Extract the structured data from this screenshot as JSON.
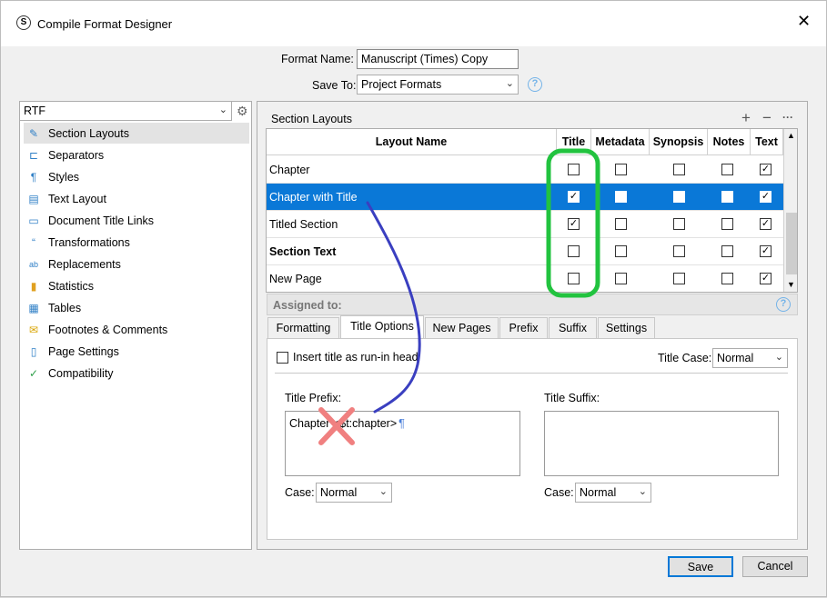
{
  "window": {
    "title": "Compile Format Designer",
    "close": "✕"
  },
  "format_name": {
    "label": "Format Name:",
    "value": "Manuscript (Times) Copy"
  },
  "save_to": {
    "label": "Save To:",
    "value": "Project Formats"
  },
  "left": {
    "output_select": "RTF",
    "items": [
      {
        "label": "Section Layouts",
        "icon": "✎"
      },
      {
        "label": "Separators",
        "icon": "⊏"
      },
      {
        "label": "Styles",
        "icon": "¶"
      },
      {
        "label": "Text Layout",
        "icon": "▤"
      },
      {
        "label": "Document Title Links",
        "icon": "▭"
      },
      {
        "label": "Transformations",
        "icon": "“"
      },
      {
        "label": "Replacements",
        "icon": "ab"
      },
      {
        "label": "Statistics",
        "icon": "▮"
      },
      {
        "label": "Tables",
        "icon": "▦"
      },
      {
        "label": "Footnotes & Comments",
        "icon": "✉"
      },
      {
        "label": "Page Settings",
        "icon": "▯"
      },
      {
        "label": "Compatibility",
        "icon": "✓"
      }
    ]
  },
  "section_layouts": {
    "heading": "Section Layouts",
    "add": "+",
    "remove": "−",
    "more": "···",
    "columns": [
      "Layout Name",
      "Title",
      "Metadata",
      "Synopsis",
      "Notes",
      "Text"
    ],
    "rows": [
      {
        "name": "Chapter",
        "checks": [
          "",
          "",
          "",
          "",
          "✓"
        ]
      },
      {
        "name": "Chapter with Title",
        "checks": [
          "✓",
          "",
          "",
          "",
          "✓"
        ]
      },
      {
        "name": "Titled Section",
        "checks": [
          "✓",
          "",
          "",
          "",
          "✓"
        ]
      },
      {
        "name": "Section Text",
        "checks": [
          "",
          "",
          "",
          "",
          "✓"
        ]
      },
      {
        "name": "New Page",
        "checks": [
          "",
          "",
          "",
          "",
          "✓"
        ]
      }
    ],
    "assigned_to": "Assigned to:"
  },
  "tabs": [
    "Formatting",
    "Title Options",
    "New Pages",
    "Prefix",
    "Suffix",
    "Settings"
  ],
  "title_options": {
    "run_in_label": "Insert title as run-in head",
    "title_case_label": "Title Case:",
    "title_case_value": "Normal",
    "prefix_label": "Title Prefix:",
    "prefix_value": "Chapter <$t:chapter>",
    "pilcrow": "¶",
    "suffix_label": "Title Suffix:",
    "suffix_value": "",
    "prefix_case_label": "Case:",
    "prefix_case_value": "Normal",
    "suffix_case_label": "Case:",
    "suffix_case_value": "Normal"
  },
  "buttons": {
    "save": "Save",
    "cancel": "Cancel"
  },
  "colors": {
    "selection": "#0a78d7",
    "highlight": "#22c33f",
    "annotation_line": "#3a3fc0",
    "cross": "#f08080"
  }
}
